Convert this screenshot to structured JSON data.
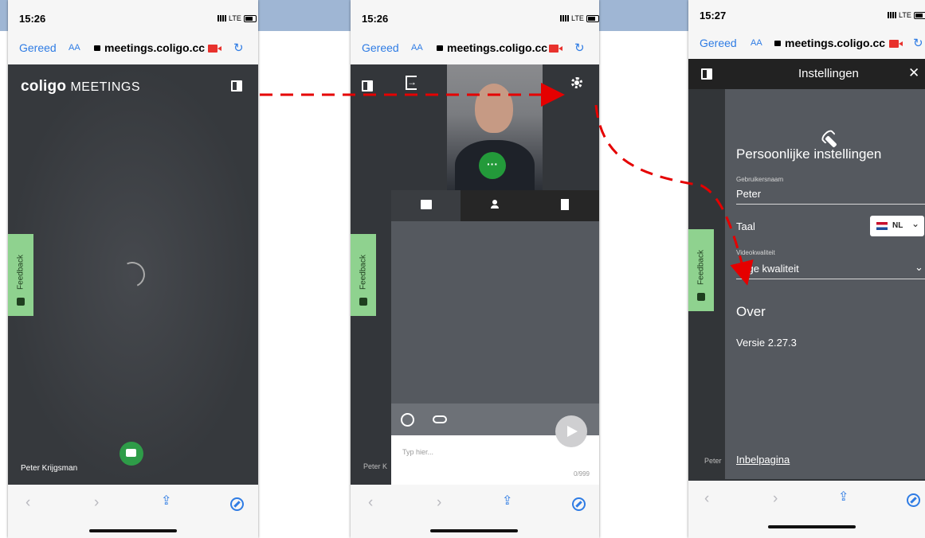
{
  "colors": {
    "accent": "#2f7ce4",
    "record": "#e8322d",
    "fab_green": "#2e9c48",
    "feedback_green": "#8fd28f",
    "annotation_arrow": "#e50000"
  },
  "browser": {
    "done_label": "Gereed",
    "aa_label": "AA",
    "url": "meetings.coligo.cc"
  },
  "status": {
    "network": "LTE"
  },
  "screen1": {
    "time": "15:26",
    "brand_bold": "coligo",
    "brand_light": "MEETINGS",
    "feedback_label": "Feedback",
    "participant_name": "Peter Krijgsman"
  },
  "screen2": {
    "time": "15:26",
    "message_placeholder": "Typ hier...",
    "char_counter": "0/999",
    "behind_name": "Peter K",
    "more_label": "···"
  },
  "screen3": {
    "time": "15:27",
    "header_title": "Instellingen",
    "personal_title": "Persoonlijke instellingen",
    "username_label": "Gebruikersnaam",
    "username_value": "Peter",
    "language_label": "Taal",
    "language_value": "NL",
    "video_label": "Videokwaliteit",
    "video_value": "Lage kwaliteit",
    "about_title": "Over",
    "version": "Versie 2.27.3",
    "dialin_link": "Inbelpagina",
    "behind_name": "Peter"
  },
  "icons": [
    "panel-toggle-icon",
    "gear-icon",
    "exit-icon",
    "chat-icon",
    "user-icon",
    "document-icon",
    "smiley-icon",
    "attach-icon",
    "send-icon",
    "wrench-icon",
    "close-icon",
    "lock-icon",
    "camera-icon",
    "reload-icon",
    "share-icon",
    "compass-icon",
    "back-icon",
    "forward-icon"
  ]
}
